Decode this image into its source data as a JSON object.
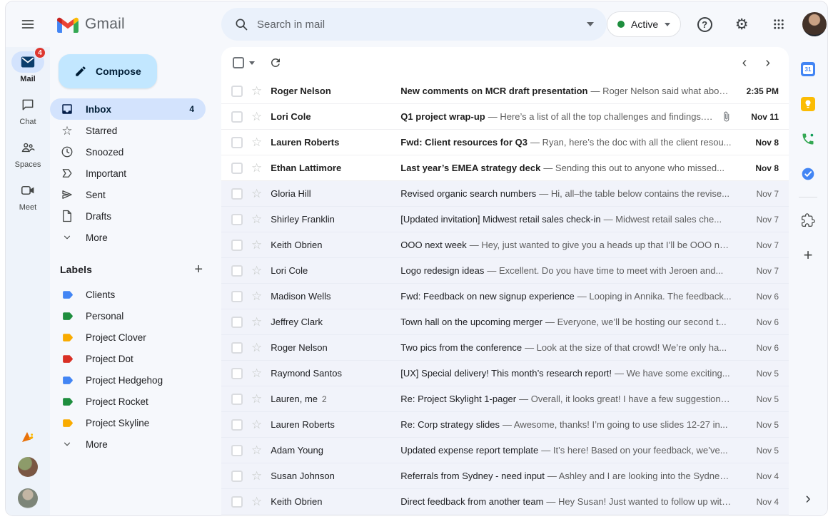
{
  "topbar": {
    "app_name": "Gmail",
    "search_placeholder": "Search in mail",
    "status_label": "Active"
  },
  "icons": {
    "star-icon": "☆",
    "prev-page-icon": "‹",
    "next-page-icon": "›",
    "plus-icon": "+",
    "help-icon": "?",
    "gear-icon": "⚙",
    "side-panel-expand-icon": "›"
  },
  "left_rail": {
    "items": [
      {
        "label": "Mail",
        "badge": "4",
        "active": true
      },
      {
        "label": "Chat"
      },
      {
        "label": "Spaces"
      },
      {
        "label": "Meet"
      }
    ]
  },
  "sidebar": {
    "compose_label": "Compose",
    "folders": [
      {
        "label": "Inbox",
        "count": "4",
        "selected": true
      },
      {
        "label": "Starred"
      },
      {
        "label": "Snoozed"
      },
      {
        "label": "Important"
      },
      {
        "label": "Sent"
      },
      {
        "label": "Drafts"
      },
      {
        "label": "More"
      }
    ],
    "labels_title": "Labels",
    "labels": [
      {
        "name": "Clients",
        "color": "#4285f4"
      },
      {
        "name": "Personal",
        "color": "#1e8e3e"
      },
      {
        "name": "Project Clover",
        "color": "#f9ab00"
      },
      {
        "name": "Project Dot",
        "color": "#d93025"
      },
      {
        "name": "Project Hedgehog",
        "color": "#4285f4"
      },
      {
        "name": "Project Rocket",
        "color": "#1e8e3e"
      },
      {
        "name": "Project Skyline",
        "color": "#f9ab00"
      }
    ],
    "labels_more": "More"
  },
  "list": {
    "emails": [
      {
        "sender": "Roger Nelson",
        "subject": "New comments on MCR draft presentation",
        "snippet": "— Roger Nelson said what abou...",
        "date": "2:35 PM",
        "unread": true
      },
      {
        "sender": "Lori Cole",
        "subject": "Q1 project wrap-up",
        "snippet": "— Here’s a list of all the top challenges and findings. Sur...",
        "date": "Nov 11",
        "unread": true,
        "attachment": true
      },
      {
        "sender": "Lauren Roberts",
        "subject": "Fwd: Client resources for Q3",
        "snippet": "— Ryan, here’s the doc with all the client resou...",
        "date": "Nov 8",
        "unread": true
      },
      {
        "sender": "Ethan Lattimore",
        "subject": "Last year’s EMEA strategy deck",
        "snippet": "— Sending this out to anyone who missed...",
        "date": "Nov 8",
        "unread": true
      },
      {
        "sender": "Gloria Hill",
        "subject": "Revised organic search numbers",
        "snippet": "— Hi, all–the table below contains the revise...",
        "date": "Nov 7"
      },
      {
        "sender": "Shirley Franklin",
        "subject": "[Updated invitation] Midwest retail sales check-in",
        "snippet": "— Midwest retail sales che...",
        "date": "Nov 7"
      },
      {
        "sender": "Keith Obrien",
        "subject": "OOO next week",
        "snippet": "— Hey, just wanted to give you a heads up that I’ll be OOO ne...",
        "date": "Nov 7"
      },
      {
        "sender": "Lori Cole",
        "subject": "Logo redesign ideas",
        "snippet": "— Excellent. Do you have time to meet with Jeroen and...",
        "date": "Nov 7"
      },
      {
        "sender": "Madison Wells",
        "subject": "Fwd: Feedback on new signup experience",
        "snippet": "— Looping in Annika. The feedback...",
        "date": "Nov 6"
      },
      {
        "sender": "Jeffrey Clark",
        "subject": "Town hall on the upcoming merger",
        "snippet": "— Everyone, we’ll be hosting our second t...",
        "date": "Nov 6"
      },
      {
        "sender": "Roger Nelson",
        "subject": "Two pics from the conference",
        "snippet": "— Look at the size of that crowd! We’re only ha...",
        "date": "Nov 6"
      },
      {
        "sender": "Raymond Santos",
        "subject": "[UX] Special delivery! This month’s research report!",
        "snippet": "— We have some exciting...",
        "date": "Nov 5"
      },
      {
        "sender": "Lauren, me",
        "thread_count": "2",
        "subject": "Re: Project Skylight 1-pager",
        "snippet": "— Overall, it looks great! I have a few suggestions...",
        "date": "Nov 5"
      },
      {
        "sender": "Lauren Roberts",
        "subject": "Re: Corp strategy slides",
        "snippet": "— Awesome, thanks! I’m going to use slides 12-27 in...",
        "date": "Nov 5"
      },
      {
        "sender": "Adam Young",
        "subject": "Updated expense report template",
        "snippet": "— It’s here! Based on your feedback, we’ve...",
        "date": "Nov 5"
      },
      {
        "sender": "Susan Johnson",
        "subject": "Referrals from Sydney - need input",
        "snippet": "— Ashley and I are looking into the Sydney ...",
        "date": "Nov 4"
      },
      {
        "sender": "Keith Obrien",
        "subject": "Direct feedback from another team",
        "snippet": "— Hey Susan! Just wanted to follow up with s...",
        "date": "Nov 4"
      }
    ]
  },
  "right_rail": {
    "calendar_day": "31"
  },
  "colors": {
    "chrome_background": "#f6f8fc",
    "rail_background": "#eef3fa",
    "search_background": "#eaf1fb",
    "compose_pill": "#c2e7ff",
    "selected_pill": "#d3e3fd",
    "unread_row": "#ffffff",
    "read_row": "#f1f3fa",
    "badge_red": "#dd3730",
    "active_status_green": "#1e8e3e"
  }
}
